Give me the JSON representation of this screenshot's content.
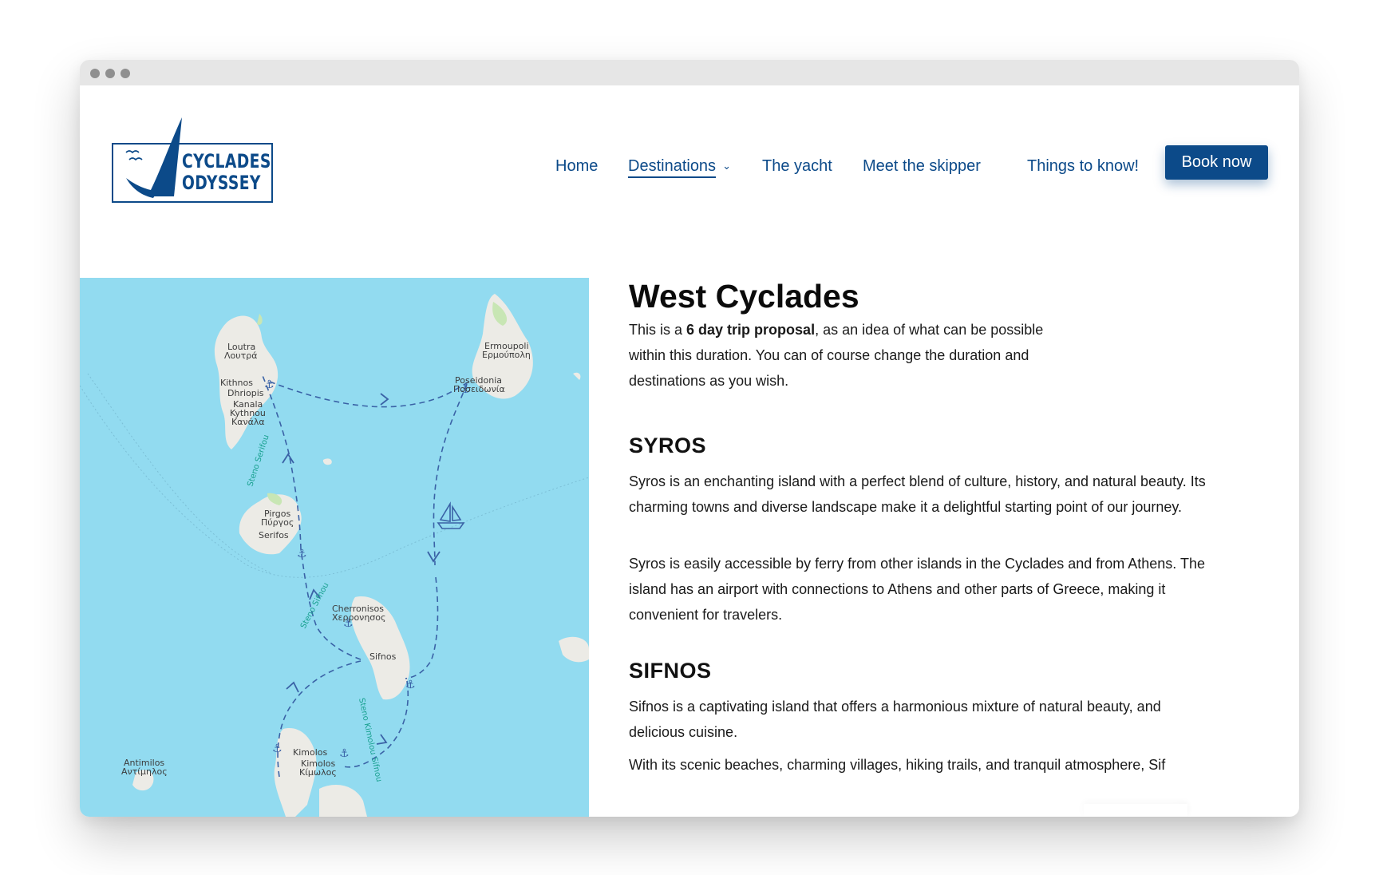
{
  "window": {
    "controls": [
      "close-dot",
      "minimize-dot",
      "zoom-dot"
    ]
  },
  "logo": {
    "line1": "CYCLADES",
    "line2": "ODYSSEY"
  },
  "nav": {
    "home": "Home",
    "destinations": "Destinations",
    "destinations_caret": "⌄",
    "yacht": "The yacht",
    "skipper": "Meet the skipper",
    "things": "Things to know!",
    "book": "Book now"
  },
  "colors": {
    "brand": "#0c4a89",
    "sea": "#92dbf0",
    "land": "#ecebe6",
    "route": "#3a62a6"
  },
  "map": {
    "labels": {
      "loutra_en": "Loutra",
      "loutra_gr": "Λουτρά",
      "kithnos": "Kithnos",
      "dhriopis": "Dhriopis",
      "kanala_en": "Kanala",
      "kythnou": "Kythnou",
      "kanala_gr": "Κανάλα",
      "ermoupoli_en": "Ermoupoli",
      "ermoupoli_gr": "Ερμούπολη",
      "poseidonia_en": "Poseidonia",
      "poseidonia_gr": "Ποσειδωνία",
      "pirgos_en": "Pirgos",
      "pirgos_gr": "Πύργος",
      "serifos": "Serifos",
      "cherronisos_en": "Cherronisos",
      "cherronisos_gr": "Χερρονησος",
      "sifnos": "Sifnos",
      "kimolos_1": "Kimolos",
      "kimolos_2": "Kimolos",
      "kimolos_gr": "Κίμωλος",
      "antimilos_en": "Antimilos",
      "antimilos_gr": "Αντίμηλος"
    },
    "straits": {
      "serifou": "Steno Serifou",
      "sifnou": "Steno Sifnou",
      "kimolou": "Steno Kimolou Sifnou"
    },
    "icons": [
      "anchor-icon",
      "sailboat-icon"
    ]
  },
  "content": {
    "title": "West Cyclades",
    "intro_pre": "This is a ",
    "intro_bold": "6 day trip proposal",
    "intro_post": ", as an idea of what can be possible within this duration. You can of course change the duration and destinations as you wish.",
    "sections": [
      {
        "title": "SYROS",
        "paragraphs": [
          "Syros is an enchanting island with a perfect blend of culture, history, and natural beauty. Its charming towns and diverse landscape make it a delightful starting point of our journey.",
          "Syros is easily accessible by ferry from other islands in the Cyclades and from Athens. The island has an airport with connections to Athens and other parts of Greece, making it convenient for travelers."
        ]
      },
      {
        "title": "SIFNOS",
        "paragraphs": [
          "Sifnos is a captivating island that offers a harmonious mixture of natural beauty, and delicious cuisine.",
          "With its scenic beaches, charming villages, hiking trails, and tranquil atmosphere, Sif"
        ]
      }
    ]
  }
}
